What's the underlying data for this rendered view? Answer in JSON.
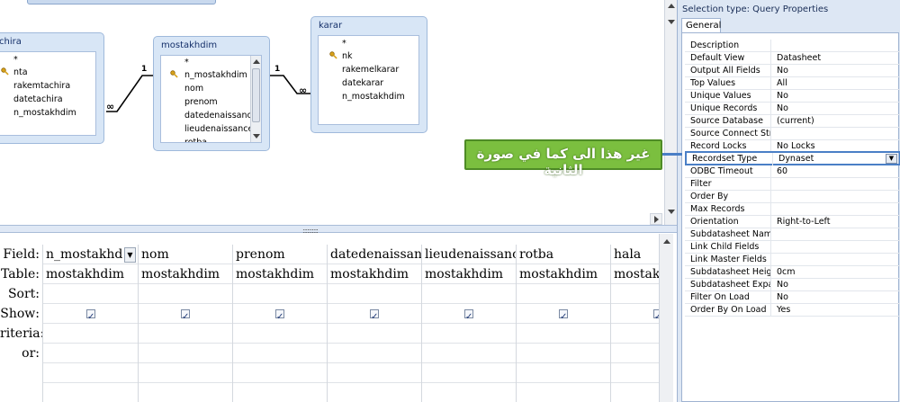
{
  "design": {
    "tables": [
      {
        "title": "tachira",
        "fields": [
          "*",
          "nta",
          "rakemtachira",
          "datetachira",
          "n_mostakhdim"
        ],
        "key_field": "nta"
      },
      {
        "title": "mostakhdim",
        "fields": [
          "*",
          "n_mostakhdim",
          "nom",
          "prenom",
          "datedenaissance",
          "lieudenaissance",
          "rotba"
        ],
        "key_field": "n_mostakhdim"
      },
      {
        "title": "karar",
        "fields": [
          "*",
          "nk",
          "rakemelkarar",
          "datekarar",
          "n_mostakhdim"
        ],
        "key_field": "nk"
      }
    ],
    "relations": [
      {
        "one": "1",
        "many": "∞"
      },
      {
        "one": "1",
        "many": "∞"
      }
    ],
    "splitter_grip": "::::::::::"
  },
  "grid": {
    "row_labels": [
      "Field:",
      "Table:",
      "Sort:",
      "Show:",
      "riteria:",
      "or:"
    ],
    "columns": [
      {
        "field": "n_mostakhd",
        "table": "mostakhdim",
        "show": true,
        "dropdown": true
      },
      {
        "field": "nom",
        "table": "mostakhdim",
        "show": true
      },
      {
        "field": "prenom",
        "table": "mostakhdim",
        "show": true
      },
      {
        "field": "datedenaissanc",
        "table": "mostakhdim",
        "show": true
      },
      {
        "field": "lieudenaissance",
        "table": "mostakhdim",
        "show": true
      },
      {
        "field": "rotba",
        "table": "mostakhdim",
        "show": true
      },
      {
        "field": "hala",
        "table": "mostak",
        "show": true
      }
    ]
  },
  "props": {
    "selection_type_label": "Selection type:  Query Properties",
    "tab_general": "General",
    "rows": [
      {
        "name": "Description",
        "value": ""
      },
      {
        "name": "Default View",
        "value": "Datasheet"
      },
      {
        "name": "Output All Fields",
        "value": "No"
      },
      {
        "name": "Top Values",
        "value": "All"
      },
      {
        "name": "Unique Values",
        "value": "No"
      },
      {
        "name": "Unique Records",
        "value": "No"
      },
      {
        "name": "Source Database",
        "value": "(current)"
      },
      {
        "name": "Source Connect Str",
        "value": ""
      },
      {
        "name": "Record Locks",
        "value": "No Locks"
      },
      {
        "name": "Recordset Type",
        "value": "Dynaset",
        "selected": true
      },
      {
        "name": "ODBC Timeout",
        "value": "60"
      },
      {
        "name": "Filter",
        "value": ""
      },
      {
        "name": "Order By",
        "value": ""
      },
      {
        "name": "Max Records",
        "value": ""
      },
      {
        "name": "Orientation",
        "value": "Right-to-Left"
      },
      {
        "name": "Subdatasheet Name",
        "value": ""
      },
      {
        "name": "Link Child Fields",
        "value": ""
      },
      {
        "name": "Link Master Fields",
        "value": ""
      },
      {
        "name": "Subdatasheet Heigh",
        "value": "0cm"
      },
      {
        "name": "Subdatasheet Expan",
        "value": "No"
      },
      {
        "name": "Filter On Load",
        "value": "No"
      },
      {
        "name": "Order By On Load",
        "value": "Yes"
      }
    ]
  },
  "annotation": {
    "text": "غير هذا الى كما في صورة الثانية",
    "color": "#7bbf3f"
  }
}
